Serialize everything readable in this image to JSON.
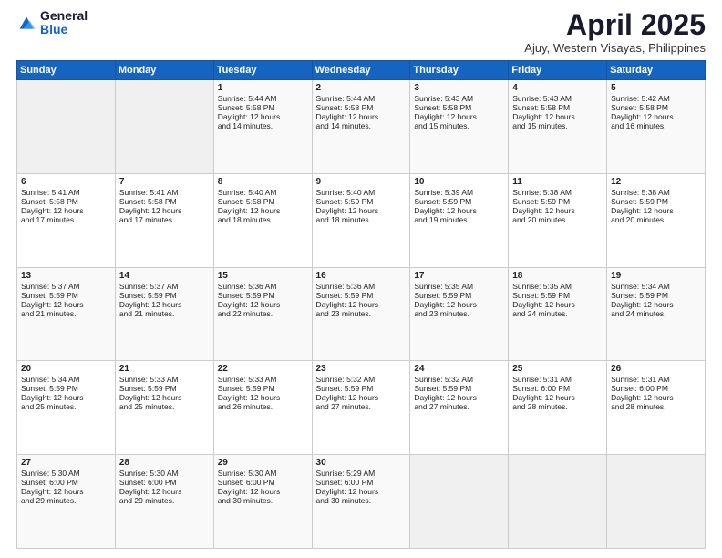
{
  "header": {
    "logo_general": "General",
    "logo_blue": "Blue",
    "title": "April 2025",
    "subtitle": "Ajuy, Western Visayas, Philippines"
  },
  "weekdays": [
    "Sunday",
    "Monday",
    "Tuesday",
    "Wednesday",
    "Thursday",
    "Friday",
    "Saturday"
  ],
  "weeks": [
    [
      {
        "day": "",
        "info": ""
      },
      {
        "day": "",
        "info": ""
      },
      {
        "day": "1",
        "info": "Sunrise: 5:44 AM\nSunset: 5:58 PM\nDaylight: 12 hours\nand 14 minutes."
      },
      {
        "day": "2",
        "info": "Sunrise: 5:44 AM\nSunset: 5:58 PM\nDaylight: 12 hours\nand 14 minutes."
      },
      {
        "day": "3",
        "info": "Sunrise: 5:43 AM\nSunset: 5:58 PM\nDaylight: 12 hours\nand 15 minutes."
      },
      {
        "day": "4",
        "info": "Sunrise: 5:43 AM\nSunset: 5:58 PM\nDaylight: 12 hours\nand 15 minutes."
      },
      {
        "day": "5",
        "info": "Sunrise: 5:42 AM\nSunset: 5:58 PM\nDaylight: 12 hours\nand 16 minutes."
      }
    ],
    [
      {
        "day": "6",
        "info": "Sunrise: 5:41 AM\nSunset: 5:58 PM\nDaylight: 12 hours\nand 17 minutes."
      },
      {
        "day": "7",
        "info": "Sunrise: 5:41 AM\nSunset: 5:58 PM\nDaylight: 12 hours\nand 17 minutes."
      },
      {
        "day": "8",
        "info": "Sunrise: 5:40 AM\nSunset: 5:58 PM\nDaylight: 12 hours\nand 18 minutes."
      },
      {
        "day": "9",
        "info": "Sunrise: 5:40 AM\nSunset: 5:59 PM\nDaylight: 12 hours\nand 18 minutes."
      },
      {
        "day": "10",
        "info": "Sunrise: 5:39 AM\nSunset: 5:59 PM\nDaylight: 12 hours\nand 19 minutes."
      },
      {
        "day": "11",
        "info": "Sunrise: 5:38 AM\nSunset: 5:59 PM\nDaylight: 12 hours\nand 20 minutes."
      },
      {
        "day": "12",
        "info": "Sunrise: 5:38 AM\nSunset: 5:59 PM\nDaylight: 12 hours\nand 20 minutes."
      }
    ],
    [
      {
        "day": "13",
        "info": "Sunrise: 5:37 AM\nSunset: 5:59 PM\nDaylight: 12 hours\nand 21 minutes."
      },
      {
        "day": "14",
        "info": "Sunrise: 5:37 AM\nSunset: 5:59 PM\nDaylight: 12 hours\nand 21 minutes."
      },
      {
        "day": "15",
        "info": "Sunrise: 5:36 AM\nSunset: 5:59 PM\nDaylight: 12 hours\nand 22 minutes."
      },
      {
        "day": "16",
        "info": "Sunrise: 5:36 AM\nSunset: 5:59 PM\nDaylight: 12 hours\nand 23 minutes."
      },
      {
        "day": "17",
        "info": "Sunrise: 5:35 AM\nSunset: 5:59 PM\nDaylight: 12 hours\nand 23 minutes."
      },
      {
        "day": "18",
        "info": "Sunrise: 5:35 AM\nSunset: 5:59 PM\nDaylight: 12 hours\nand 24 minutes."
      },
      {
        "day": "19",
        "info": "Sunrise: 5:34 AM\nSunset: 5:59 PM\nDaylight: 12 hours\nand 24 minutes."
      }
    ],
    [
      {
        "day": "20",
        "info": "Sunrise: 5:34 AM\nSunset: 5:59 PM\nDaylight: 12 hours\nand 25 minutes."
      },
      {
        "day": "21",
        "info": "Sunrise: 5:33 AM\nSunset: 5:59 PM\nDaylight: 12 hours\nand 25 minutes."
      },
      {
        "day": "22",
        "info": "Sunrise: 5:33 AM\nSunset: 5:59 PM\nDaylight: 12 hours\nand 26 minutes."
      },
      {
        "day": "23",
        "info": "Sunrise: 5:32 AM\nSunset: 5:59 PM\nDaylight: 12 hours\nand 27 minutes."
      },
      {
        "day": "24",
        "info": "Sunrise: 5:32 AM\nSunset: 5:59 PM\nDaylight: 12 hours\nand 27 minutes."
      },
      {
        "day": "25",
        "info": "Sunrise: 5:31 AM\nSunset: 6:00 PM\nDaylight: 12 hours\nand 28 minutes."
      },
      {
        "day": "26",
        "info": "Sunrise: 5:31 AM\nSunset: 6:00 PM\nDaylight: 12 hours\nand 28 minutes."
      }
    ],
    [
      {
        "day": "27",
        "info": "Sunrise: 5:30 AM\nSunset: 6:00 PM\nDaylight: 12 hours\nand 29 minutes."
      },
      {
        "day": "28",
        "info": "Sunrise: 5:30 AM\nSunset: 6:00 PM\nDaylight: 12 hours\nand 29 minutes."
      },
      {
        "day": "29",
        "info": "Sunrise: 5:30 AM\nSunset: 6:00 PM\nDaylight: 12 hours\nand 30 minutes."
      },
      {
        "day": "30",
        "info": "Sunrise: 5:29 AM\nSunset: 6:00 PM\nDaylight: 12 hours\nand 30 minutes."
      },
      {
        "day": "",
        "info": ""
      },
      {
        "day": "",
        "info": ""
      },
      {
        "day": "",
        "info": ""
      }
    ]
  ]
}
